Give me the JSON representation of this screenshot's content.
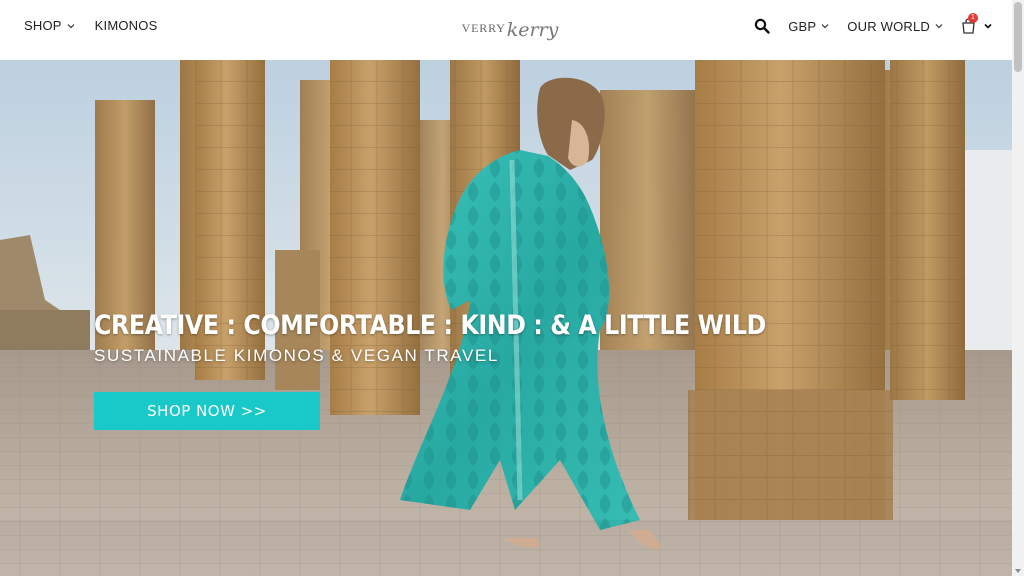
{
  "header": {
    "nav_left": [
      {
        "label": "SHOP",
        "has_dropdown": true
      },
      {
        "label": "KIMONOS",
        "has_dropdown": false
      }
    ],
    "logo": {
      "part1": "VERRY",
      "part2": "kerry"
    },
    "currency": "GBP",
    "our_world": "OUR WORLD",
    "cart_count": "1"
  },
  "hero": {
    "headline": "CREATIVE : COMFORTABLE : KIND : & A LITTLE WILD",
    "subline": "SUSTAINABLE KIMONOS & VEGAN TRAVEL",
    "cta_label": "SHOP NOW >>"
  },
  "colors": {
    "cta": "#19c8c8",
    "badge": "#e53935",
    "kimono": "#2fb9b1",
    "stone": "#b8905a",
    "sky": "#c9d7e2"
  },
  "icons": [
    "search-icon",
    "cart-icon",
    "chevron-down-icon"
  ]
}
